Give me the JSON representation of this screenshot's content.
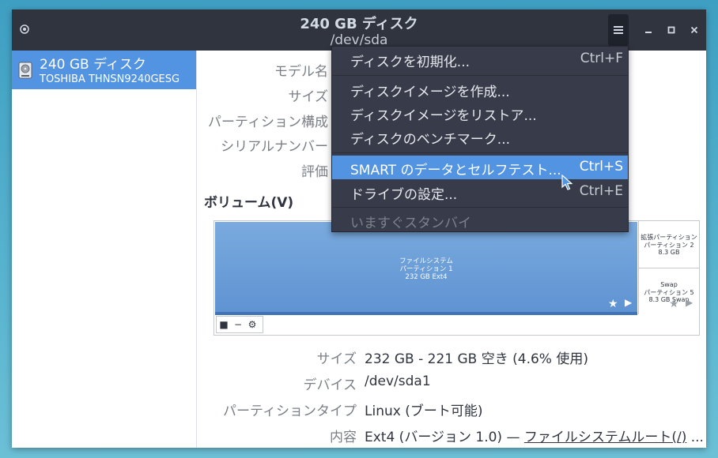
{
  "window": {
    "title": "240 GB ディスク",
    "subtitle": "/dev/sda"
  },
  "sidebar": {
    "drives": [
      {
        "name": "240 GB ディスク",
        "model": "TOSHIBA THNSN9240GESG",
        "selected": true
      }
    ]
  },
  "drive_info": {
    "labels": [
      "モデル名",
      "サイズ",
      "パーティション構成",
      "シリアルナンバー",
      "評価"
    ]
  },
  "volumes": {
    "title": "ボリューム(V)",
    "partitions": [
      {
        "line1": "ファイルシステム",
        "line2": "パーティション 1",
        "line3": "232 GB Ext4"
      },
      {
        "line1": "拡張パーティション",
        "line2": "パーティション 2",
        "line3": "8.3 GB"
      },
      {
        "line1": "Swap",
        "line2": "パーティション 5",
        "line3": "8.3 GB Swap"
      }
    ],
    "toolbar": {
      "stop": "■",
      "remove": "−",
      "options": "⚙"
    }
  },
  "partition_details": [
    {
      "label": "サイズ",
      "value": "232 GB - 221 GB 空き (4.6% 使用)"
    },
    {
      "label": "デバイス",
      "value": "/dev/sda1"
    },
    {
      "label": "パーティションタイプ",
      "value": "Linux (ブート可能)"
    },
    {
      "label": "内容",
      "value": "Ext4 (バージョン 1.0) — ",
      "link": "ファイルシステムルート(/)",
      "suffix": " ..."
    }
  ],
  "menu": {
    "items": [
      {
        "label": "ディスクを初期化...",
        "accel": "Ctrl+F"
      },
      {
        "label": "ディスクイメージを作成...",
        "accel": ""
      },
      {
        "label": "ディスクイメージをリストア...",
        "accel": ""
      },
      {
        "label": "ディスクのベンチマーク...",
        "accel": ""
      },
      {
        "label": "SMART のデータとセルフテスト...",
        "accel": "Ctrl+S",
        "highlighted": true
      },
      {
        "label": "ドライブの設定...",
        "accel": "Ctrl+E"
      },
      {
        "label": "いますぐスタンバイ",
        "accel": "",
        "disabled": true
      }
    ]
  },
  "colors": {
    "titlebar": "#2f343f",
    "accent": "#5294e2",
    "menu_bg": "#383c4a",
    "partition_fill": "#6d9fd8"
  }
}
